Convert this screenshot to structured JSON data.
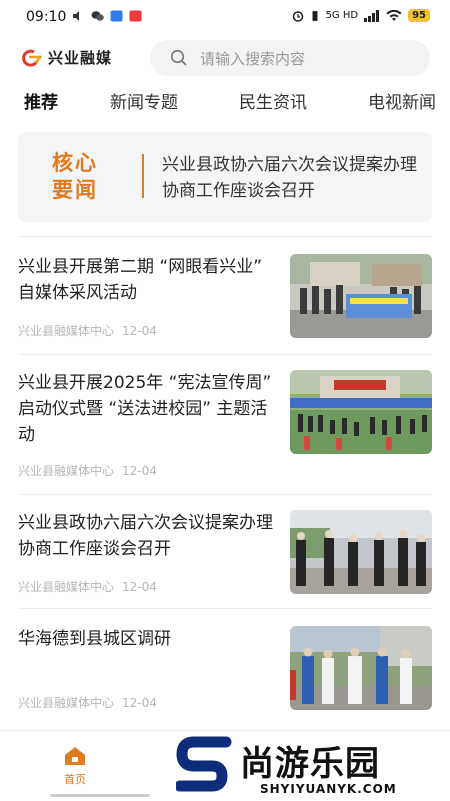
{
  "status_bar": {
    "time": "09:10",
    "network": "5G HD",
    "battery": "95"
  },
  "header": {
    "app_name": "兴业融媒",
    "search_placeholder": "请输入搜索内容"
  },
  "tabs": [
    {
      "label": "推荐",
      "active": true
    },
    {
      "label": "新闻专题",
      "active": false
    },
    {
      "label": "民生资讯",
      "active": false
    },
    {
      "label": "电视新闻",
      "active": false
    }
  ],
  "headline": {
    "label_line1": "核心",
    "label_line2": "要闻",
    "title": "兴业县政协六届六次会议提案办理协商工作座谈会召开"
  },
  "news": [
    {
      "title": "兴业县开展第二期 “网眼看兴业” 自媒体采风活动",
      "source": "兴业县融媒体中心",
      "date": "12-04"
    },
    {
      "title": "兴业县开展2025年 “宪法宣传周” 启动仪式暨 “送法进校园” 主题活动",
      "source": "兴业县融媒体中心",
      "date": "12-04"
    },
    {
      "title": "兴业县政协六届六次会议提案办理协商工作座谈会召开",
      "source": "兴业县融媒体中心",
      "date": "12-04"
    },
    {
      "title": "华海德到县城区调研",
      "source": "兴业县融媒体中心",
      "date": "12-04"
    }
  ],
  "bottom_nav": {
    "home_label": "首页"
  },
  "watermark": {
    "text": "尚游乐园",
    "url": "SHYIYUANYK.COM"
  },
  "colors": {
    "accent": "#e07b1f",
    "meta": "#b5b5b5",
    "card_bg": "#f4f5f7"
  }
}
